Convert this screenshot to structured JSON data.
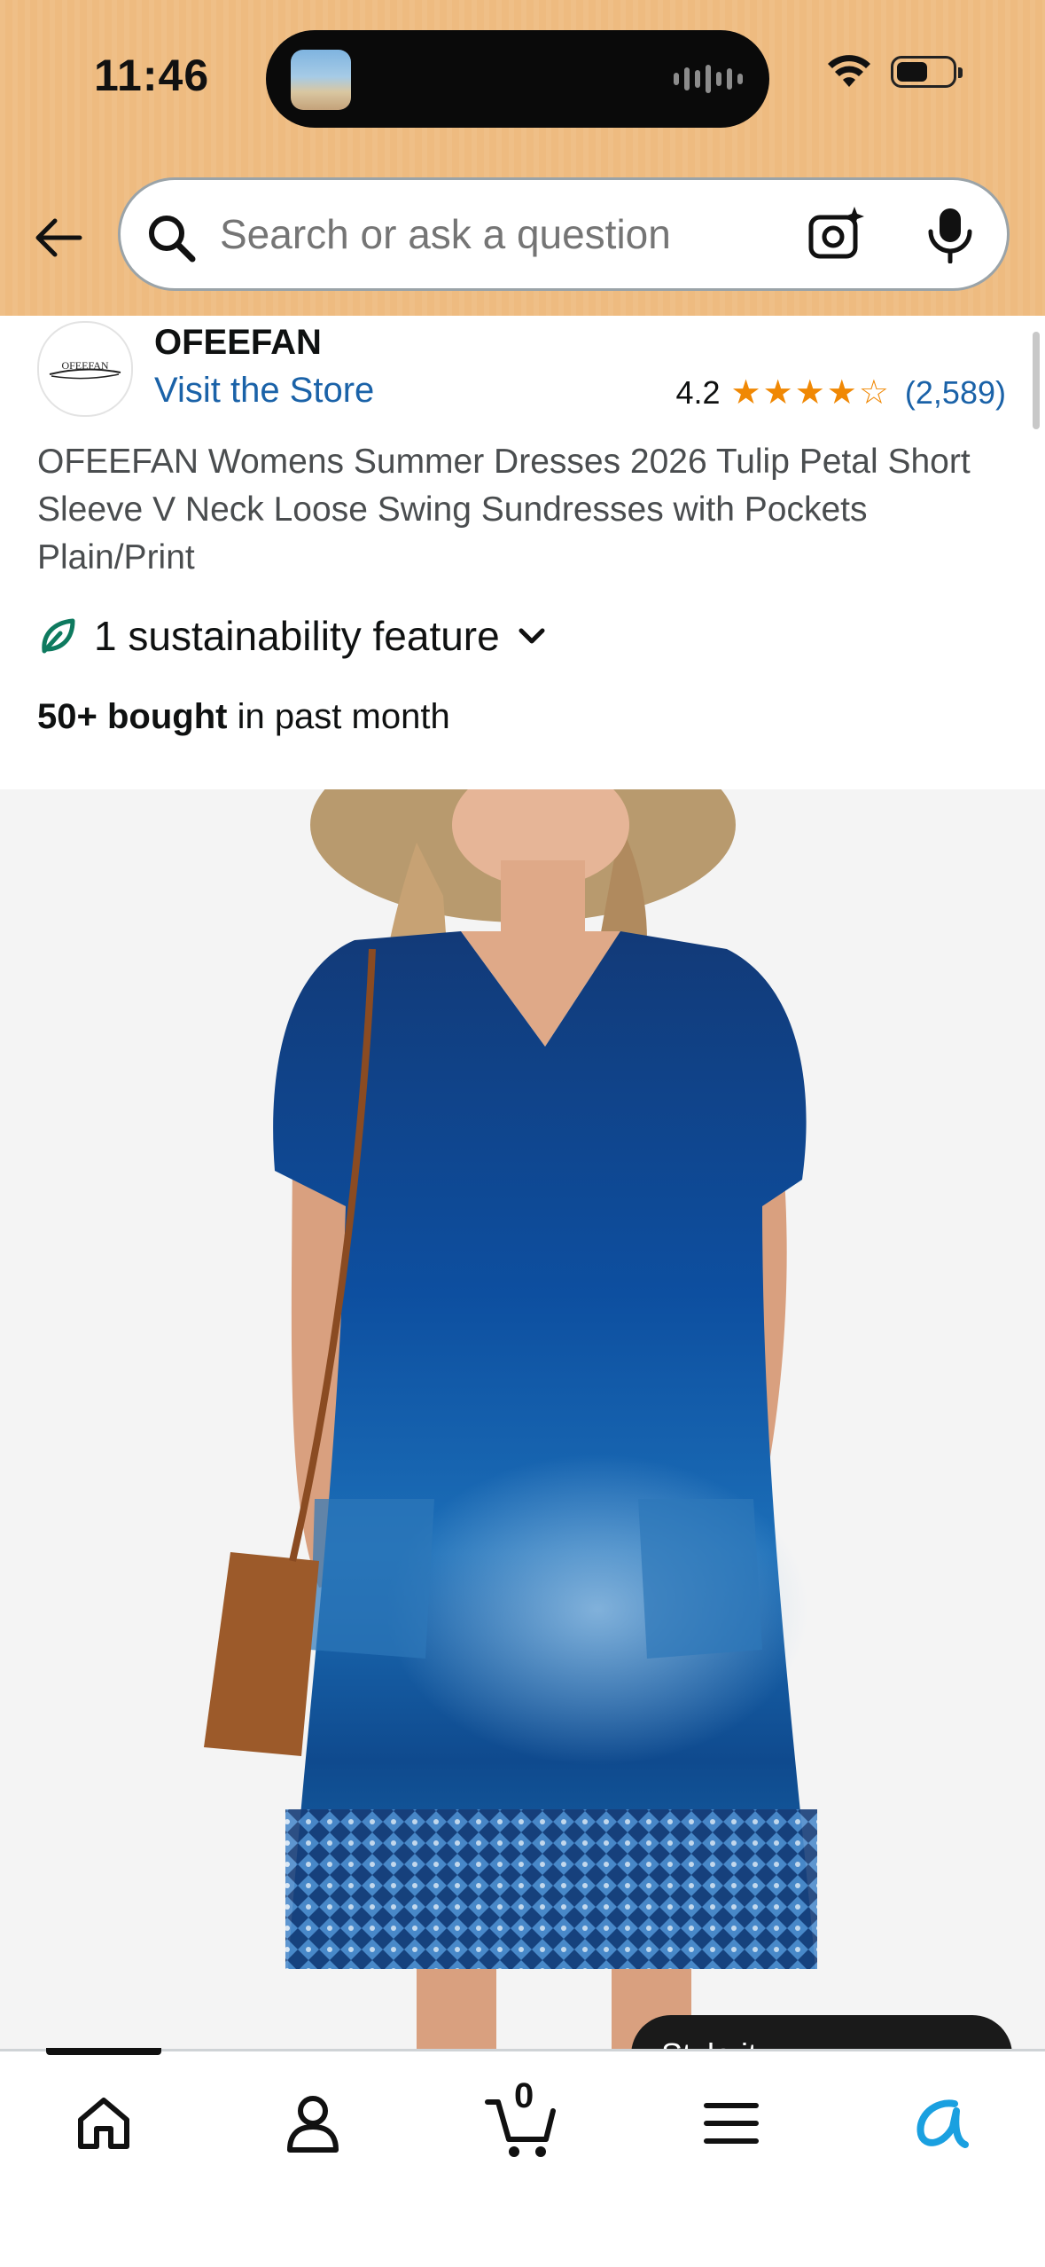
{
  "status_bar": {
    "time": "11:46"
  },
  "search": {
    "placeholder": "Search or ask a question"
  },
  "store": {
    "brand": "OFEEFAN",
    "logo_text": "OFEEFAN",
    "visit_link": "Visit the Store",
    "rating": "4.2",
    "rating_stars": 4.2,
    "review_count": "(2,589)"
  },
  "product": {
    "title": "OFEEFAN Womens Summer Dresses 2026 Tulip Petal Short Sleeve V Neck Loose Swing Sundresses with Pockets Plain/Print",
    "sustainability": "1 sustainability feature",
    "bought_bold": "50+ bought",
    "bought_rest": " in past month"
  },
  "style_pill": {
    "label": "Style it..."
  },
  "bottom_nav": {
    "cart_count": "0"
  },
  "colors": {
    "header": "#eebb80",
    "link": "#1a62a8",
    "star": "#f08804",
    "alexa": "#1aa0e0"
  },
  "icons": [
    "back-arrow-icon",
    "search-icon",
    "camera-sparkle-icon",
    "mic-icon",
    "leaf-icon",
    "chevron-down-icon",
    "home-icon",
    "account-icon",
    "cart-icon",
    "menu-icon",
    "alexa-icon"
  ]
}
